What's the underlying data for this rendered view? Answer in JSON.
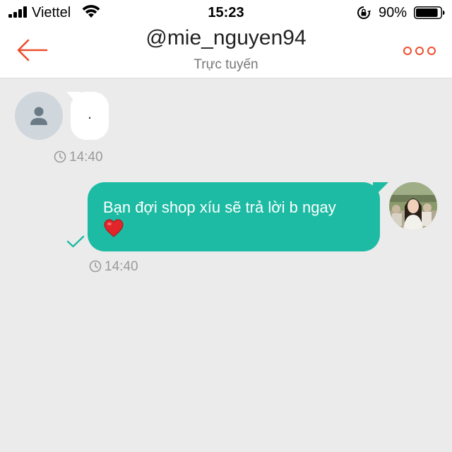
{
  "status_bar": {
    "carrier": "Viettel",
    "time": "15:23",
    "battery_percent": "90%",
    "battery_level": 0.9,
    "icons": [
      "signal-icon",
      "wifi-icon",
      "orientation-lock-icon",
      "battery-icon"
    ]
  },
  "header": {
    "title": "@mie_nguyen94",
    "subtitle": "Trực tuyến",
    "icons": [
      "back-arrow-icon",
      "more-options-icon"
    ],
    "accent_color": "#ee4d2d"
  },
  "messages": [
    {
      "direction": "incoming",
      "text": ".",
      "time": "14:40",
      "avatar": "default-user-avatar"
    },
    {
      "direction": "outgoing",
      "text": "Bạn đợi shop xíu sẽ trả lời b ngay",
      "emoji": "❤️",
      "time": "14:40",
      "status_icon": "sent-check-icon",
      "avatar": "user-photo-avatar",
      "bubble_color": "#1dbba3"
    }
  ],
  "colors": {
    "background": "#ebebeb",
    "check": "#1dbba3",
    "timestamp": "#9a9a9a"
  }
}
